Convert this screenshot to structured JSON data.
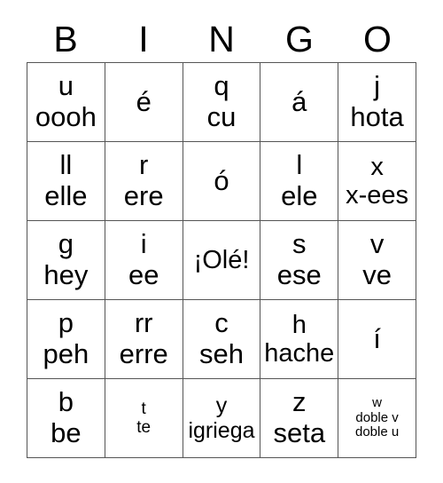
{
  "card": {
    "title_letters": [
      "B",
      "I",
      "N",
      "G",
      "O"
    ],
    "columns": 5,
    "rows": 5,
    "free_space_label": "¡Olé!",
    "grid_line_color": "#555555",
    "background_color": "#ffffff",
    "text_color": "#000000",
    "cells": [
      [
        {
          "lines": [
            "u",
            "oooh"
          ],
          "size": "xl"
        },
        {
          "lines": [
            "é"
          ],
          "size": "xl"
        },
        {
          "lines": [
            "q",
            "cu"
          ],
          "size": "xl"
        },
        {
          "lines": [
            "á"
          ],
          "size": "xl"
        },
        {
          "lines": [
            "j",
            "hota"
          ],
          "size": "xl"
        }
      ],
      [
        {
          "lines": [
            "ll",
            "elle"
          ],
          "size": "xl"
        },
        {
          "lines": [
            "r",
            "ere"
          ],
          "size": "xl"
        },
        {
          "lines": [
            "ó"
          ],
          "size": "xl"
        },
        {
          "lines": [
            "l",
            "ele"
          ],
          "size": "xl"
        },
        {
          "lines": [
            "x",
            "x-ees"
          ],
          "size": "lg"
        }
      ],
      [
        {
          "lines": [
            "g",
            "hey"
          ],
          "size": "xl"
        },
        {
          "lines": [
            "i",
            "ee"
          ],
          "size": "xl"
        },
        {
          "lines": [
            "¡Olé!"
          ],
          "size": "lg"
        },
        {
          "lines": [
            "s",
            "ese"
          ],
          "size": "xl"
        },
        {
          "lines": [
            "v",
            "ve"
          ],
          "size": "xl"
        }
      ],
      [
        {
          "lines": [
            "p",
            "peh"
          ],
          "size": "xl"
        },
        {
          "lines": [
            "rr",
            "erre"
          ],
          "size": "xl"
        },
        {
          "lines": [
            "c",
            "seh"
          ],
          "size": "xl"
        },
        {
          "lines": [
            "h",
            "hache"
          ],
          "size": "lg"
        },
        {
          "lines": [
            "í"
          ],
          "size": "xl"
        }
      ],
      [
        {
          "lines": [
            "b",
            "be"
          ],
          "size": "xl"
        },
        {
          "lines": [
            "t",
            "te"
          ],
          "size": "sm"
        },
        {
          "lines": [
            "y",
            "igriega"
          ],
          "size": "md"
        },
        {
          "lines": [
            "z",
            "seta"
          ],
          "size": "xl"
        },
        {
          "lines": [
            "w",
            "doble v",
            "doble u"
          ],
          "size": "xs"
        }
      ]
    ]
  }
}
